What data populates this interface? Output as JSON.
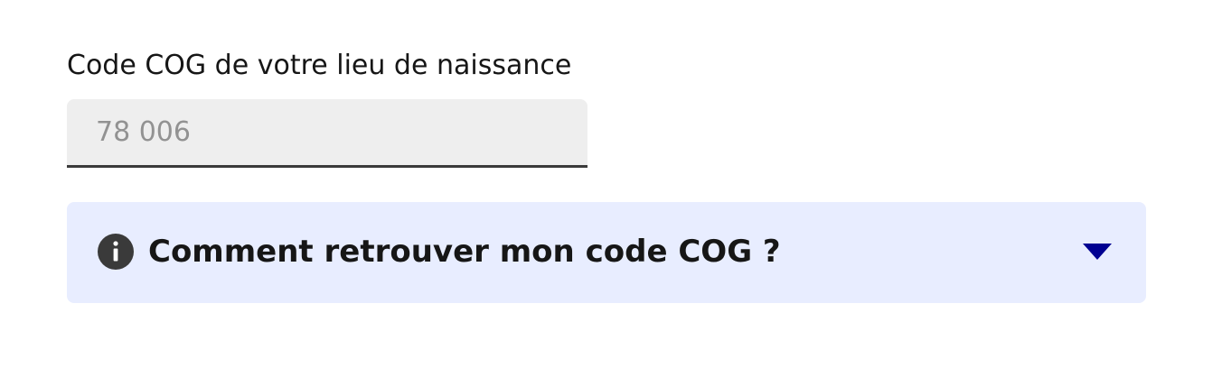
{
  "field": {
    "label": "Code COG de votre lieu de naissance",
    "placeholder": "78 006",
    "value": ""
  },
  "accordion": {
    "title": "Comment retrouver mon code COG ?",
    "expanded": false
  },
  "icons": {
    "info": "info-circle-icon",
    "toggle": "caret-down-icon"
  },
  "colors": {
    "accordion_background": "#e8edff",
    "input_background": "#eeeeee",
    "input_border": "#3a3a3a",
    "caret": "#000091",
    "text": "#161616",
    "placeholder": "#929292"
  }
}
